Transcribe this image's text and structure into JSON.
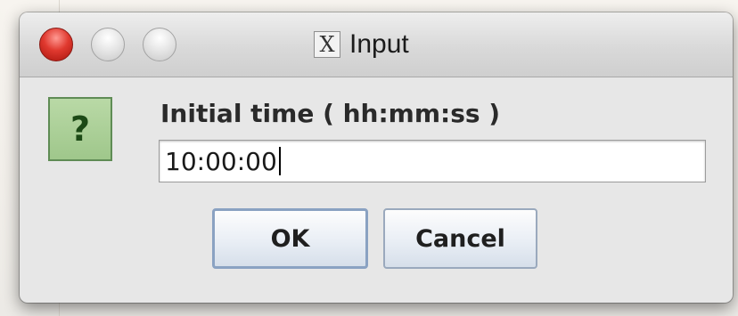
{
  "window": {
    "title": "Input",
    "title_icon": "x11-icon",
    "title_icon_glyph": "X"
  },
  "dialog": {
    "icon": "question-icon",
    "icon_glyph": "?",
    "prompt": "Initial time ( hh:mm:ss )",
    "input_value": "10:00:00",
    "ok_label": "OK",
    "cancel_label": "Cancel"
  },
  "colors": {
    "close_button": "#e0392f",
    "icon_background": "#9fc78b",
    "default_button_border": "#8aa2c2"
  }
}
